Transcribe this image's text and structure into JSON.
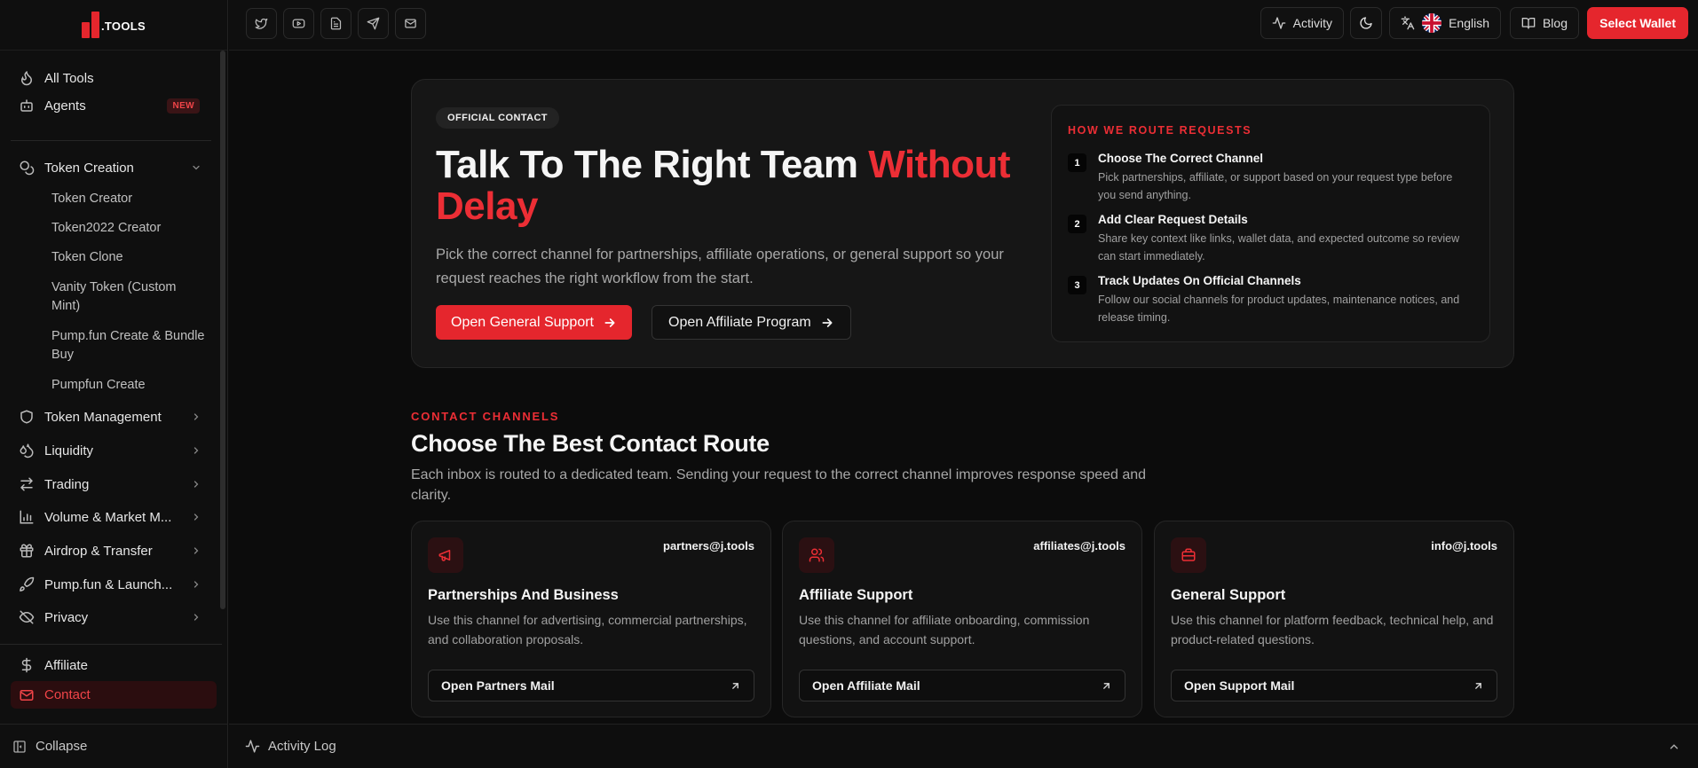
{
  "brand": {
    "logo_text": ".TOOLS"
  },
  "sidebar": {
    "all_tools": "All Tools",
    "agents": "Agents",
    "agents_badge": "NEW",
    "token_creation": "Token Creation",
    "token_creation_items": [
      "Token Creator",
      "Token2022 Creator",
      "Token Clone",
      "Vanity Token (Custom Mint)",
      "Pump.fun Create & Bundle Buy",
      "Pumpfun Create"
    ],
    "token_management": "Token Management",
    "liquidity": "Liquidity",
    "trading": "Trading",
    "volume": "Volume & Market M...",
    "airdrop": "Airdrop & Transfer",
    "pumpfun": "Pump.fun & Launch...",
    "privacy": "Privacy",
    "affiliate": "Affiliate",
    "contact": "Contact",
    "collapse": "Collapse"
  },
  "topbar": {
    "activity": "Activity",
    "language": "English",
    "blog": "Blog",
    "wallet": "Select Wallet"
  },
  "hero": {
    "pill": "OFFICIAL CONTACT",
    "title_main": "Talk To The Right Team ",
    "title_accent": "Without Delay",
    "description": "Pick the correct channel for partnerships, affiliate operations, or general support so your request reaches the right workflow from the start.",
    "primary_button": "Open General Support",
    "secondary_button": "Open Affiliate Program"
  },
  "route": {
    "heading": "HOW WE ROUTE REQUESTS",
    "steps": [
      {
        "num": "1",
        "title": "Choose The Correct Channel",
        "desc": "Pick partnerships, affiliate, or support based on your request type before you send anything."
      },
      {
        "num": "2",
        "title": "Add Clear Request Details",
        "desc": "Share key context like links, wallet data, and expected outcome so review can start immediately."
      },
      {
        "num": "3",
        "title": "Track Updates On Official Channels",
        "desc": "Follow our social channels for product updates, maintenance notices, and release timing."
      }
    ]
  },
  "channels": {
    "label": "CONTACT CHANNELS",
    "title": "Choose The Best Contact Route",
    "description": "Each inbox is routed to a dedicated team. Sending your request to the correct channel improves response speed and clarity.",
    "cards": [
      {
        "email": "partners@j.tools",
        "title": "Partnerships And Business",
        "desc": "Use this channel for advertising, commercial partnerships, and collaboration proposals.",
        "button": "Open Partners Mail"
      },
      {
        "email": "affiliates@j.tools",
        "title": "Affiliate Support",
        "desc": "Use this channel for affiliate onboarding, commission questions, and account support.",
        "button": "Open Affiliate Mail"
      },
      {
        "email": "info@j.tools",
        "title": "General Support",
        "desc": "Use this channel for platform feedback, technical help, and product-related questions.",
        "button": "Open Support Mail"
      }
    ]
  },
  "activity_log": "Activity Log",
  "colors": {
    "accent": "#e5262d",
    "background": "#0c0c0c"
  }
}
